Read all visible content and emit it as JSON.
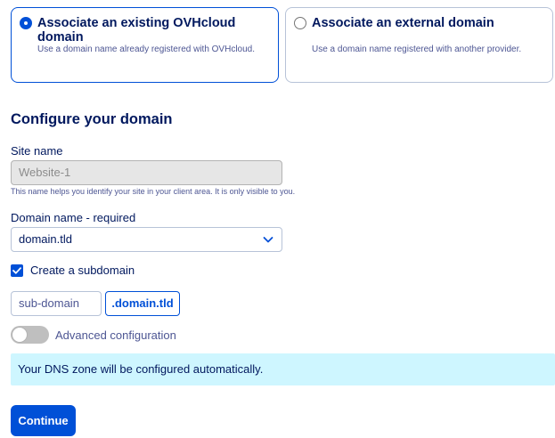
{
  "options": [
    {
      "title": "Associate an existing OVHcloud domain",
      "description": "Use a domain name already registered with OVHcloud.",
      "selected": true
    },
    {
      "title": "Associate an external domain",
      "description": "Use a domain name registered with another provider.",
      "selected": false
    }
  ],
  "form": {
    "section_title": "Configure your domain",
    "site_name": {
      "label": "Site name",
      "value": "Website-1",
      "helper": "This name helps you identify your site in your client area. It is only visible to you."
    },
    "domain_name": {
      "label": "Domain name - required",
      "selected": "domain.tld"
    },
    "subdomain": {
      "checkbox_label": "Create a subdomain",
      "checked": true,
      "placeholder": "sub-domain",
      "suffix": ".domain.tld"
    },
    "advanced": {
      "label": "Advanced configuration",
      "enabled": false
    },
    "info_banner": "Your DNS zone will be configured automatically.",
    "continue_label": "Continue"
  },
  "colors": {
    "primary": "#0050d7",
    "text": "#00185e",
    "info_background": "#cef6ff"
  }
}
